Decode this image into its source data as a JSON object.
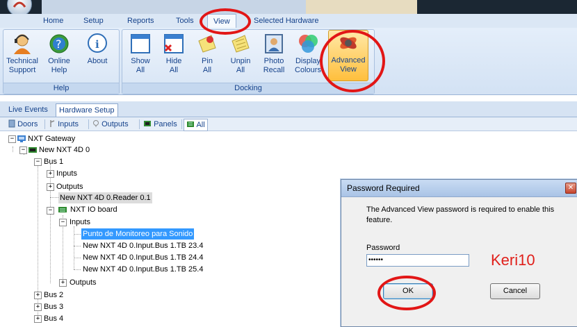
{
  "ribbon_tabs": [
    "Home",
    "Setup",
    "Reports",
    "Tools",
    "View",
    "Selected Hardware"
  ],
  "active_ribbon_tab": "View",
  "ribbon": {
    "groups": {
      "help": {
        "label": "Help",
        "buttons": [
          {
            "line1": "Technical",
            "line2": "Support",
            "icon": "technical-support-icon"
          },
          {
            "line1": "Online",
            "line2": "Help",
            "icon": "online-help-icon"
          },
          {
            "line1": "About",
            "line2": "",
            "icon": "about-icon"
          }
        ]
      },
      "docking": {
        "label": "Docking",
        "buttons": [
          {
            "line1": "Show",
            "line2": "All",
            "icon": "show-all-icon"
          },
          {
            "line1": "Hide",
            "line2": "All",
            "icon": "hide-all-icon"
          },
          {
            "line1": "Pin",
            "line2": "All",
            "icon": "pin-all-icon"
          },
          {
            "line1": "Unpin",
            "line2": "All",
            "icon": "unpin-all-icon"
          },
          {
            "line1": "Photo",
            "line2": "Recall",
            "icon": "photo-recall-icon"
          },
          {
            "line1": "Display",
            "line2": "Colours",
            "icon": "display-colours-icon"
          },
          {
            "line1": "Advanced",
            "line2": "View",
            "icon": "advanced-view-icon"
          }
        ]
      }
    }
  },
  "workspace_tabs": [
    "Live Events",
    "Hardware Setup"
  ],
  "active_workspace_tab": "Hardware Setup",
  "filters": [
    "Doors",
    "Inputs",
    "Outputs",
    "Panels",
    "All"
  ],
  "active_filter": "All",
  "tree": {
    "root": "NXT Gateway",
    "controller": "New NXT 4D 0",
    "bus1": "Bus 1",
    "inputs": "Inputs",
    "outputs": "Outputs",
    "reader": "New NXT 4D 0.Reader 0.1",
    "io_board": "NXT IO board",
    "io_inputs": "Inputs",
    "input_items": [
      "Punto de Monitoreo para Sonido",
      "New NXT 4D 0.Input.Bus 1.TB 23.4",
      "New NXT 4D 0.Input.Bus 1.TB 24.4",
      "New NXT 4D 0.Input.Bus 1.TB 25.4"
    ],
    "io_outputs": "Outputs",
    "bus2": "Bus 2",
    "bus3": "Bus 3",
    "bus4": "Bus 4"
  },
  "dialog": {
    "title": "Password Required",
    "message": "The Advanced View password is required to enable this feature.",
    "password_label": "Password",
    "password_value": "••••••",
    "hint": "Keri10",
    "ok_label": "OK",
    "cancel_label": "Cancel"
  },
  "colors": {
    "annotation_red": "#e21616",
    "selection_blue": "#3399ff"
  }
}
